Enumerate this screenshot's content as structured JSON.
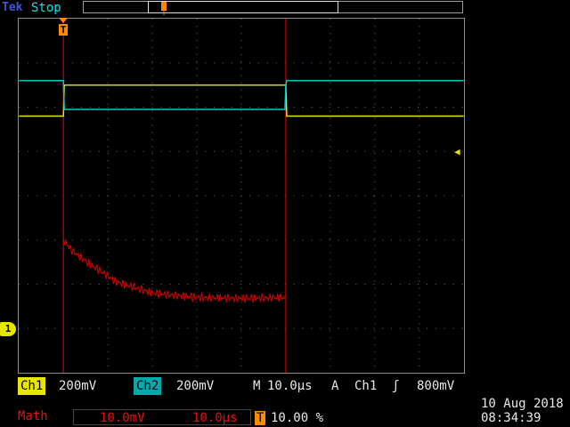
{
  "header": {
    "brand": "Tek",
    "status": "Stop"
  },
  "trigger_marker": "T",
  "channel_marker": "1",
  "readouts": {
    "ch1_label": "Ch1",
    "ch1_scale": "200mV",
    "ch2_label": "Ch2",
    "ch2_scale": "200mV",
    "timebase_label": "M",
    "timebase_value": "10.0µs",
    "trigger_mode": "A",
    "trigger_source": "Ch1",
    "trigger_slope": "ʃ",
    "trigger_level": "800mV",
    "math_label": "Math",
    "math_scale": "10.0mV",
    "math_time": "10.0µs",
    "position_icon": "T",
    "position_value": "10.00 %"
  },
  "datetime": {
    "date": "10 Aug 2018",
    "time": "08:34:39"
  },
  "colors": {
    "ch1": "#e6e600",
    "ch2": "#00cccc",
    "math": "#cc0000",
    "trigger": "#ff8a00"
  },
  "chart_data": {
    "type": "line",
    "xlabel": "",
    "ylabel": "",
    "grid": true,
    "xlim": [
      -10,
      90
    ],
    "ylim": [
      -4,
      4
    ],
    "series": [
      {
        "x": [
          -10,
          0,
          0.2,
          50,
          50.2,
          90
        ],
        "values": [
          1.8,
          1.8,
          2.5,
          2.5,
          1.8,
          1.8
        ]
      },
      {
        "x": [
          -10,
          0,
          0.2,
          49.8,
          50,
          50.2,
          90
        ],
        "values": [
          2.6,
          2.6,
          1.95,
          1.95,
          2.5,
          2.6,
          2.6
        ]
      },
      {
        "x": [
          0,
          2,
          6,
          12,
          20,
          30,
          40,
          50
        ],
        "values": [
          -1,
          -1.25,
          -1.55,
          -1.95,
          -2.2,
          -2.3,
          -2.32,
          -2.3
        ]
      }
    ]
  }
}
